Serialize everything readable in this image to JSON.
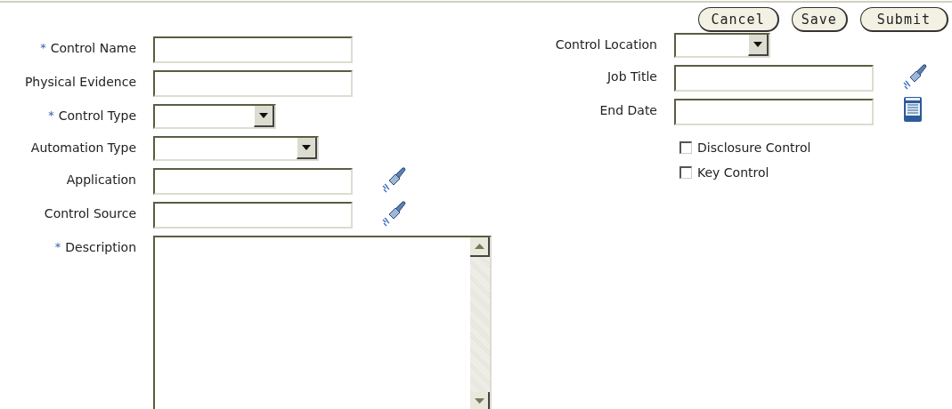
{
  "buttons": [
    {
      "label": "Cancel"
    },
    {
      "label": "Save"
    },
    {
      "label": "Submit"
    }
  ],
  "left_fields": [
    {
      "label": "Control Name",
      "required": true,
      "kind": "text"
    },
    {
      "label": "Physical Evidence",
      "required": false,
      "kind": "text"
    },
    {
      "label": "Control Type",
      "required": true,
      "kind": "select-short"
    },
    {
      "label": "Automation Type",
      "required": false,
      "kind": "select-long"
    },
    {
      "label": "Application",
      "required": false,
      "kind": "text",
      "action": {
        "kind": "lookup"
      }
    },
    {
      "label": "Control Source",
      "required": false,
      "kind": "text",
      "action": {
        "kind": "lookup"
      }
    },
    {
      "label": "Description",
      "required": true,
      "kind": "textarea"
    }
  ],
  "right_fields": [
    {
      "label": "Control Location",
      "required": false,
      "kind": "select-short"
    },
    {
      "label": "Job Title",
      "required": false,
      "kind": "text",
      "action": {
        "kind": "lookup"
      }
    },
    {
      "label": "End Date",
      "required": false,
      "kind": "text",
      "action": {
        "kind": "calendar"
      }
    }
  ],
  "checkboxes": [
    {
      "label": "Disclosure Control",
      "checked": false
    },
    {
      "label": "Key Control",
      "checked": false
    }
  ],
  "required_mark": "*"
}
